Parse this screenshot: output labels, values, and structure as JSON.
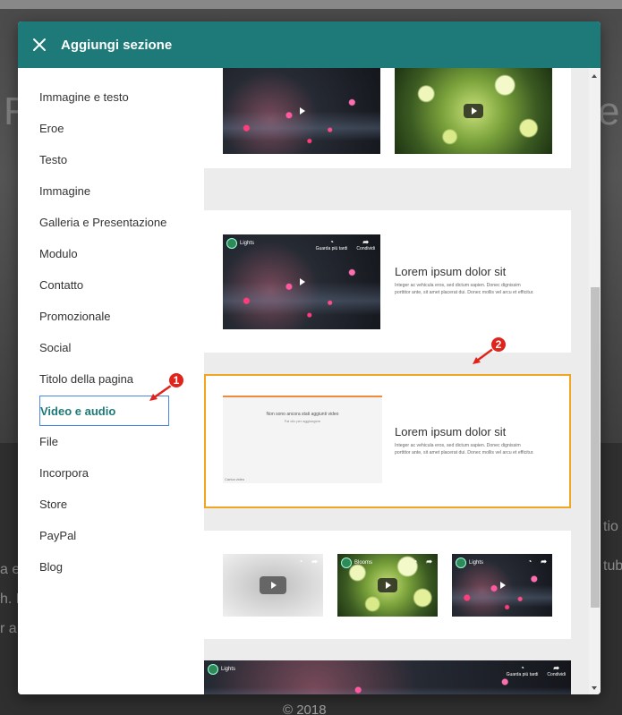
{
  "background": {
    "big_left": "R",
    "big_right": "e",
    "side_right_1": "tio",
    "side_right_2": "tuba",
    "side_left_1": "a e",
    "side_left_2": "h. D",
    "side_left_3": "r a",
    "footer": "© 2018"
  },
  "modal": {
    "title": "Aggiungi sezione",
    "header_color": "#1d7a78"
  },
  "sidebar": {
    "items": [
      {
        "label": "Immagine e testo"
      },
      {
        "label": "Eroe"
      },
      {
        "label": "Testo"
      },
      {
        "label": "Immagine"
      },
      {
        "label": "Galleria e Presentazione"
      },
      {
        "label": "Modulo"
      },
      {
        "label": "Contatto"
      },
      {
        "label": "Promozionale"
      },
      {
        "label": "Social"
      },
      {
        "label": "Titolo della pagina"
      },
      {
        "label": "Video e audio"
      },
      {
        "label": "File"
      },
      {
        "label": "Incorpora"
      },
      {
        "label": "Store"
      },
      {
        "label": "PayPal"
      },
      {
        "label": "Blog"
      }
    ],
    "active_index": 10
  },
  "cards": {
    "card2": {
      "video_title": "Lights",
      "icon1_label": "Guarda più tardi",
      "icon2_label": "Condividi",
      "heading": "Lorem ipsum dolor sit",
      "body_line1": "Integer ac vehicula eros, sed dictum sapien. Donec dignissim",
      "body_line2": "porttitor ante, sit amet placerat dui. Donec mollis vel arcu et efficitur."
    },
    "card3": {
      "empty_line1": "Non sono ancora stati aggiunti video",
      "empty_line2": "Fai clic per aggiungere",
      "empty_foot": "Carica video",
      "heading": "Lorem ipsum dolor sit",
      "body_line1": "Integer ac vehicula eros, sed dictum sapien. Donec dignissim",
      "body_line2": "porttitor ante, sit amet placerat dui. Donec mollis vel arcu et efficitur."
    },
    "card4": {
      "video2_title": "Blooms",
      "video3_title": "Lights"
    },
    "card5": {
      "video_title": "Lights",
      "icon1_label": "Guarda più tardi",
      "icon2_label": "Condividi"
    }
  },
  "markers": {
    "m1": "1",
    "m2": "2",
    "color": "#e0241b"
  },
  "accent_selected": "#f0a623"
}
